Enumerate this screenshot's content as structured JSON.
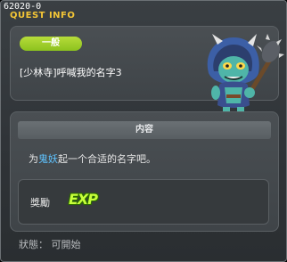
{
  "window": {
    "id_label": "62020-0",
    "title": "QUEST INFO"
  },
  "quest": {
    "category_badge": "一般",
    "name": "[少林寺]呼喊我的名字3"
  },
  "content": {
    "header": "内容",
    "description_prefix": "为",
    "description_highlight": "鬼妖",
    "description_suffix": "起一个合适的名字吧。"
  },
  "reward": {
    "label": "獎勵",
    "exp_text": "EXP"
  },
  "status": {
    "text": "狀態： 可開始"
  },
  "colors": {
    "title": "#f4c636",
    "badge": "#9acb27",
    "highlight": "#5fc3ff",
    "exp": "#c7ff3a"
  },
  "icons": {
    "npc": "goblin-with-spiked-club-icon"
  }
}
